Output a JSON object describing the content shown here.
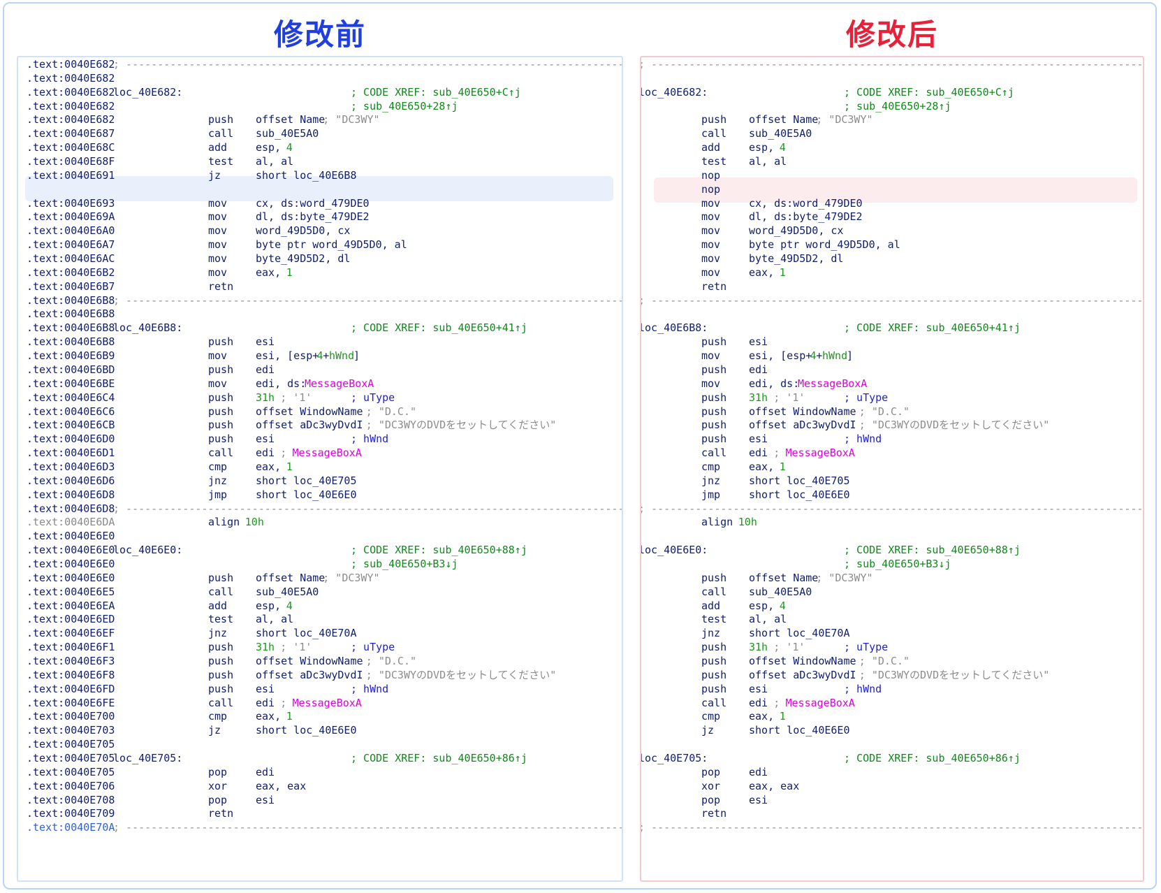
{
  "titles": {
    "before": "修改前",
    "after": "修改后"
  },
  "separator": "; ---------------------------------------------------------------------------------------------",
  "before_lines": [
    {
      "a": ".text:0040E682",
      "kind": "sep"
    },
    {
      "a": ".text:0040E682"
    },
    {
      "a": ".text:0040E682",
      "label": "loc_40E682:",
      "x": "; CODE XREF: sub_40E650+C↑j"
    },
    {
      "a": ".text:0040E682",
      "x": "; sub_40E650+28↑j"
    },
    {
      "a": ".text:0040E682",
      "m": "push",
      "o": "offset Name",
      "c": "; \"DC3WY\""
    },
    {
      "a": ".text:0040E687",
      "m": "call",
      "o": "sub_40E5A0"
    },
    {
      "a": ".text:0040E68C",
      "m": "add",
      "o": "esp, ",
      "n": "4"
    },
    {
      "a": ".text:0040E68F",
      "m": "test",
      "o": "al, al"
    },
    {
      "a": ".text:0040E691",
      "m": "jz",
      "o": "short loc_40E6B8"
    },
    {
      "blank": true
    },
    {
      "a": ".text:0040E693",
      "m": "mov",
      "o": "cx, ds:word_479DE0"
    },
    {
      "a": ".text:0040E69A",
      "m": "mov",
      "o": "dl, ds:byte_479DE2"
    },
    {
      "a": ".text:0040E6A0",
      "m": "mov",
      "o": "word_49D5D0, cx"
    },
    {
      "a": ".text:0040E6A7",
      "m": "mov",
      "o": "byte ptr word_49D5D0, al"
    },
    {
      "a": ".text:0040E6AC",
      "m": "mov",
      "o": "byte_49D5D2, dl"
    },
    {
      "a": ".text:0040E6B2",
      "m": "mov",
      "o": "eax, ",
      "n": "1"
    },
    {
      "a": ".text:0040E6B7",
      "m": "retn"
    },
    {
      "a": ".text:0040E6B8",
      "kind": "sep"
    },
    {
      "a": ".text:0040E6B8"
    },
    {
      "a": ".text:0040E6B8",
      "label": "loc_40E6B8:",
      "x": "; CODE XREF: sub_40E650+41↑j"
    },
    {
      "a": ".text:0040E6B8",
      "m": "push",
      "o": "esi"
    },
    {
      "a": ".text:0040E6B9",
      "m": "mov",
      "o": "esi, [esp+",
      "n": "4",
      "o2": "+",
      "v": "hWnd",
      "o3": "]"
    },
    {
      "a": ".text:0040E6BD",
      "m": "push",
      "o": "edi"
    },
    {
      "a": ".text:0040E6BE",
      "m": "mov",
      "o": "edi, ds:",
      "p": "MessageBoxA"
    },
    {
      "a": ".text:0040E6C4",
      "m": "push",
      "n": "31h",
      "c": " ; '1'",
      "bc": "; uType"
    },
    {
      "a": ".text:0040E6C6",
      "m": "push",
      "o": "offset WindowName",
      "c": " ; \"D.C.\""
    },
    {
      "a": ".text:0040E6CB",
      "m": "push",
      "o": "offset aDc3wyDvdI",
      "c": " ; \"DC3WYのDVDをセットしてください\""
    },
    {
      "a": ".text:0040E6D0",
      "m": "push",
      "o": "esi",
      "bc": "; hWnd"
    },
    {
      "a": ".text:0040E6D1",
      "m": "call",
      "o": "edi",
      "c": " ; ",
      "p2": "MessageBoxA"
    },
    {
      "a": ".text:0040E6D3",
      "m": "cmp",
      "o": "eax, ",
      "n": "1"
    },
    {
      "a": ".text:0040E6D6",
      "m": "jnz",
      "o": "short loc_40E705"
    },
    {
      "a": ".text:0040E6D8",
      "m": "jmp",
      "o": "short loc_40E6E0"
    },
    {
      "a": ".text:0040E6D8",
      "kind": "sep"
    },
    {
      "a": ".text:0040E6DA",
      "grey": true,
      "m": "align",
      "n": " 10h"
    },
    {
      "a": ".text:0040E6E0"
    },
    {
      "a": ".text:0040E6E0",
      "label": "loc_40E6E0:",
      "x": "; CODE XREF: sub_40E650+88↑j"
    },
    {
      "a": ".text:0040E6E0",
      "x": "; sub_40E650+B3↓j"
    },
    {
      "a": ".text:0040E6E0",
      "m": "push",
      "o": "offset Name",
      "c": "; \"DC3WY\""
    },
    {
      "a": ".text:0040E6E5",
      "m": "call",
      "o": "sub_40E5A0"
    },
    {
      "a": ".text:0040E6EA",
      "m": "add",
      "o": "esp, ",
      "n": "4"
    },
    {
      "a": ".text:0040E6ED",
      "m": "test",
      "o": "al, al"
    },
    {
      "a": ".text:0040E6EF",
      "m": "jnz",
      "o": "short loc_40E70A"
    },
    {
      "a": ".text:0040E6F1",
      "m": "push",
      "n": "31h",
      "c": " ; '1'",
      "bc": "; uType"
    },
    {
      "a": ".text:0040E6F3",
      "m": "push",
      "o": "offset WindowName",
      "c": " ; \"D.C.\""
    },
    {
      "a": ".text:0040E6F8",
      "m": "push",
      "o": "offset aDc3wyDvdI",
      "c": " ; \"DC3WYのDVDをセットしてください\""
    },
    {
      "a": ".text:0040E6FD",
      "m": "push",
      "o": "esi",
      "bc": "; hWnd"
    },
    {
      "a": ".text:0040E6FE",
      "m": "call",
      "o": "edi",
      "c": " ; ",
      "p2": "MessageBoxA"
    },
    {
      "a": ".text:0040E700",
      "m": "cmp",
      "o": "eax, ",
      "n": "1"
    },
    {
      "a": ".text:0040E703",
      "m": "jz",
      "o": "short loc_40E6E0"
    },
    {
      "a": ".text:0040E705"
    },
    {
      "a": ".text:0040E705",
      "label": "loc_40E705:",
      "x": "; CODE XREF: sub_40E650+86↑j"
    },
    {
      "a": ".text:0040E705",
      "m": "pop",
      "o": "edi"
    },
    {
      "a": ".text:0040E706",
      "m": "xor",
      "o": "eax, eax"
    },
    {
      "a": ".text:0040E708",
      "m": "pop",
      "o": "esi"
    },
    {
      "a": ".text:0040E709",
      "m": "retn"
    },
    {
      "a": ".text:0040E70A",
      "blue": true,
      "kind": "sep"
    }
  ],
  "after_lines": [
    {
      "kind": "sep"
    },
    {
      "blank": true
    },
    {
      "label": "loc_40E682:",
      "x": "; CODE XREF: sub_40E650+C↑j"
    },
    {
      "x": "; sub_40E650+28↑j"
    },
    {
      "m": "push",
      "o": "offset Name",
      "c": "; \"DC3WY\""
    },
    {
      "m": "call",
      "o": "sub_40E5A0"
    },
    {
      "m": "add",
      "o": "esp, ",
      "n": "4"
    },
    {
      "m": "test",
      "o": "al, al"
    },
    {
      "m": "nop"
    },
    {
      "m": "nop"
    },
    {
      "m": "mov",
      "o": "cx, ds:word_479DE0"
    },
    {
      "m": "mov",
      "o": "dl, ds:byte_479DE2"
    },
    {
      "m": "mov",
      "o": "word_49D5D0, cx"
    },
    {
      "m": "mov",
      "o": "byte ptr word_49D5D0, al"
    },
    {
      "m": "mov",
      "o": "byte_49D5D2, dl"
    },
    {
      "m": "mov",
      "o": "eax, ",
      "n": "1"
    },
    {
      "m": "retn"
    },
    {
      "kind": "sep"
    },
    {
      "blank": true
    },
    {
      "label": "loc_40E6B8:",
      "x": "; CODE XREF: sub_40E650+41↑j"
    },
    {
      "m": "push",
      "o": "esi"
    },
    {
      "m": "mov",
      "o": "esi, [esp+",
      "n": "4",
      "o2": "+",
      "v": "hWnd",
      "o3": "]"
    },
    {
      "m": "push",
      "o": "edi"
    },
    {
      "m": "mov",
      "o": "edi, ds:",
      "p": "MessageBoxA"
    },
    {
      "m": "push",
      "n": "31h",
      "c": " ; '1'",
      "bc": "; uType"
    },
    {
      "m": "push",
      "o": "offset WindowName",
      "c": " ; \"D.C.\""
    },
    {
      "m": "push",
      "o": "offset aDc3wyDvdI",
      "c": " ; \"DC3WYのDVDをセットしてください\""
    },
    {
      "m": "push",
      "o": "esi",
      "bc": "; hWnd"
    },
    {
      "m": "call",
      "o": "edi",
      "c": " ; ",
      "p2": "MessageBoxA"
    },
    {
      "m": "cmp",
      "o": "eax, ",
      "n": "1"
    },
    {
      "m": "jnz",
      "o": "short loc_40E705"
    },
    {
      "m": "jmp",
      "o": "short loc_40E6E0"
    },
    {
      "kind": "sep"
    },
    {
      "m": "align",
      "n": " 10h"
    },
    {
      "blank": true
    },
    {
      "label": "loc_40E6E0:",
      "x": "; CODE XREF: sub_40E650+88↑j"
    },
    {
      "x": "; sub_40E650+B3↓j"
    },
    {
      "m": "push",
      "o": "offset Name",
      "c": "; \"DC3WY\""
    },
    {
      "m": "call",
      "o": "sub_40E5A0"
    },
    {
      "m": "add",
      "o": "esp, ",
      "n": "4"
    },
    {
      "m": "test",
      "o": "al, al"
    },
    {
      "m": "jnz",
      "o": "short loc_40E70A"
    },
    {
      "m": "push",
      "n": "31h",
      "c": " ; '1'",
      "bc": "; uType"
    },
    {
      "m": "push",
      "o": "offset WindowName",
      "c": " ; \"D.C.\""
    },
    {
      "m": "push",
      "o": "offset aDc3wyDvdI",
      "c": " ; \"DC3WYのDVDをセットしてください\""
    },
    {
      "m": "push",
      "o": "esi",
      "bc": "; hWnd"
    },
    {
      "m": "call",
      "o": "edi",
      "c": " ; ",
      "p2": "MessageBoxA"
    },
    {
      "m": "cmp",
      "o": "eax, ",
      "n": "1"
    },
    {
      "m": "jz",
      "o": "short loc_40E6E0"
    },
    {
      "blank": true
    },
    {
      "label": "loc_40E705:",
      "x": "; CODE XREF: sub_40E650+86↑j"
    },
    {
      "m": "pop",
      "o": "edi"
    },
    {
      "m": "xor",
      "o": "eax, eax"
    },
    {
      "m": "pop",
      "o": "esi"
    },
    {
      "m": "retn"
    },
    {
      "kind": "sep"
    }
  ],
  "colors": {
    "before_accent": "#1f3fe0",
    "after_accent": "#e8213a",
    "before_highlight": "#eaf0fb",
    "after_highlight": "#fdecee",
    "code_xref": "#0f8a1a",
    "api_name": "#e000e0",
    "default_text": "#12206e"
  }
}
